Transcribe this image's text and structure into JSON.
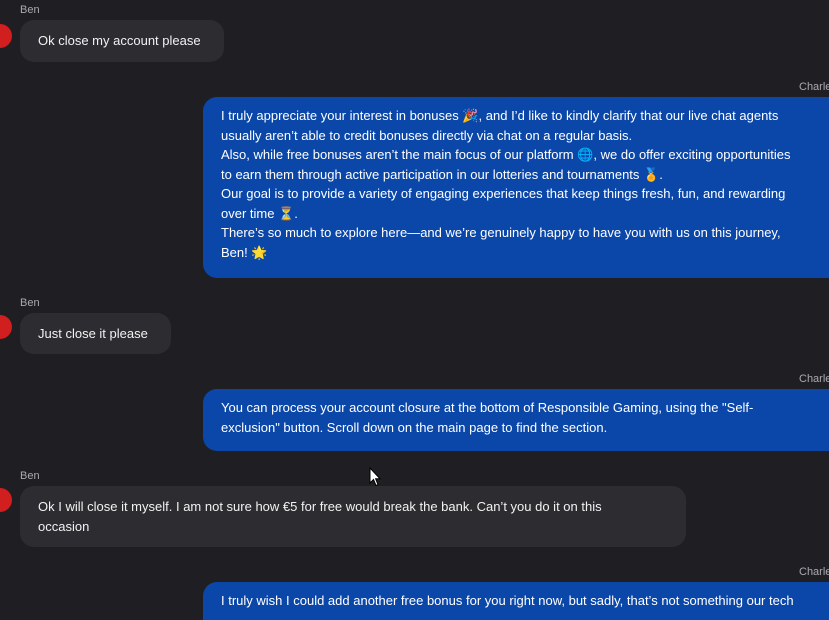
{
  "messages": [
    {
      "sender": "Ben",
      "role": "user",
      "lines": [
        "Ok close my account please"
      ]
    },
    {
      "sender": "Charle",
      "role": "agent",
      "lines": [
        "I truly appreciate your interest in bonuses 🎉, and I’d like to kindly clarify that our live chat agents",
        "usually aren’t able to credit bonuses directly via chat on a regular basis.",
        "Also, while free bonuses aren’t the main focus of our platform 🌐, we do offer exciting opportunities",
        "to earn them through active participation in our lotteries and tournaments 🏅.",
        "Our goal is to provide a variety of engaging experiences that keep things fresh, fun, and rewarding",
        "over time ⏳.",
        "There’s so much to explore here—and we’re genuinely happy to have you with us on this journey,",
        "Ben! 🌟"
      ]
    },
    {
      "sender": "Ben",
      "role": "user",
      "lines": [
        "Just close it please"
      ]
    },
    {
      "sender": "Charle",
      "role": "agent",
      "lines": [
        "You can process your account closure at the bottom of Responsible Gaming, using the \"Self-",
        "exclusion\" button. Scroll down on the main page to find the section."
      ]
    },
    {
      "sender": "Ben",
      "role": "user",
      "lines": [
        "Ok I will close it myself. I am not sure how €5 for free would break the bank. Can’t you do it on this",
        "occasion"
      ]
    },
    {
      "sender": "Charle",
      "role": "agent",
      "lines": [
        "I truly wish I could add another free bonus for you right now, but sadly, that’s not something our tech"
      ]
    }
  ],
  "colors": {
    "background": "#1f1f23",
    "user_bubble": "#2c2c31",
    "agent_bubble": "#0a47a9",
    "avatar": "#d11e1e"
  },
  "icons": {
    "avatar": "avatar-circle",
    "cursor": "mouse-pointer-icon"
  }
}
